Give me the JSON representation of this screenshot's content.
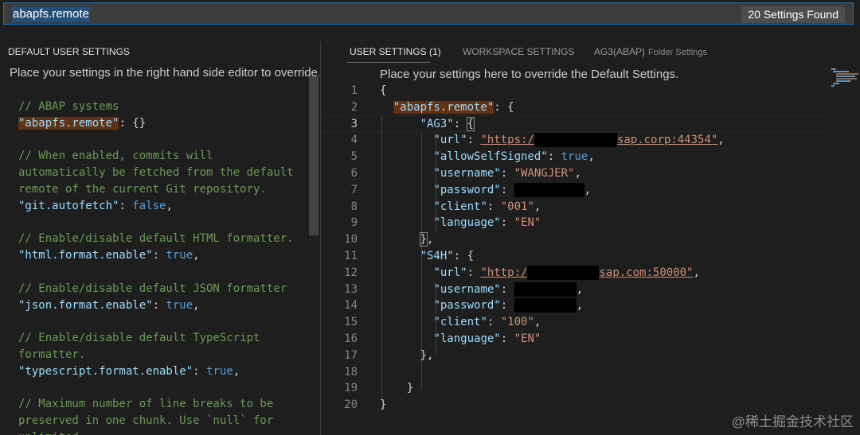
{
  "search": {
    "value": "abapfs.remote",
    "count_label": "20 Settings Found"
  },
  "left": {
    "title": "DEFAULT USER SETTINGS",
    "hint": "Place your settings in the right hand side editor to override.",
    "lines": [
      {
        "comment": "// ABAP systems"
      },
      {
        "key": "\"abapfs.remote\"",
        "rest": ": {}"
      },
      {
        "blank": true
      },
      {
        "comment": "// When enabled, commits will"
      },
      {
        "comment": "automatically be fetched from the default"
      },
      {
        "comment": "remote of the current Git repository."
      },
      {
        "key": "\"git.autofetch\"",
        "rest": ": ",
        "val": "false",
        "tail": ","
      },
      {
        "blank": true
      },
      {
        "comment": "// Enable/disable default HTML formatter."
      },
      {
        "key": "\"html.format.enable\"",
        "rest": ": ",
        "val": "true",
        "tail": ","
      },
      {
        "blank": true
      },
      {
        "comment": "// Enable/disable default JSON formatter"
      },
      {
        "key": "\"json.format.enable\"",
        "rest": ": ",
        "val": "true",
        "tail": ","
      },
      {
        "blank": true
      },
      {
        "comment": "// Enable/disable default TypeScript"
      },
      {
        "comment": "formatter."
      },
      {
        "key": "\"typescript.format.enable\"",
        "rest": ": ",
        "val": "true",
        "tail": ","
      },
      {
        "blank": true
      },
      {
        "comment": "// Maximum number of line breaks to be"
      },
      {
        "comment": "preserved in one chunk. Use `null` for"
      },
      {
        "comment": "unlimited."
      }
    ]
  },
  "tabs": {
    "user": "USER SETTINGS (1)",
    "workspace": "WORKSPACE SETTINGS",
    "folder": "AG3(ABAP)",
    "folder_sub": "Folder Settings"
  },
  "right": {
    "hint": "Place your settings here to override the Default Settings.",
    "line_numbers": [
      "1",
      "2",
      "3",
      "4",
      "5",
      "6",
      "7",
      "8",
      "9",
      "10",
      "11",
      "12",
      "13",
      "14",
      "15",
      "16",
      "17",
      "18",
      "19",
      "20"
    ],
    "brace_open": "{",
    "brace_close": "}",
    "remote_key": "\"abapfs.remote\"",
    "ag3_key": "\"AG3\"",
    "s4h_key": "\"S4H\"",
    "url_key": "\"url\"",
    "ag3_url_start": "\"https:/",
    "ag3_url_end": "sap.corp:44354\"",
    "allow_key": "\"allowSelfSigned\"",
    "allow_val": "true",
    "username_key": "\"username\"",
    "ag3_user": "\"WANGJER\"",
    "password_key": "\"password\"",
    "client_key": "\"client\"",
    "ag3_client": "\"001\"",
    "language_key": "\"language\"",
    "lang_val": "\"EN\"",
    "s4h_url_start": "\"http:/",
    "s4h_url_end": "sap.com:50000\"",
    "s4h_client": "\"100\""
  },
  "watermark": "@稀土掘金技术社区"
}
